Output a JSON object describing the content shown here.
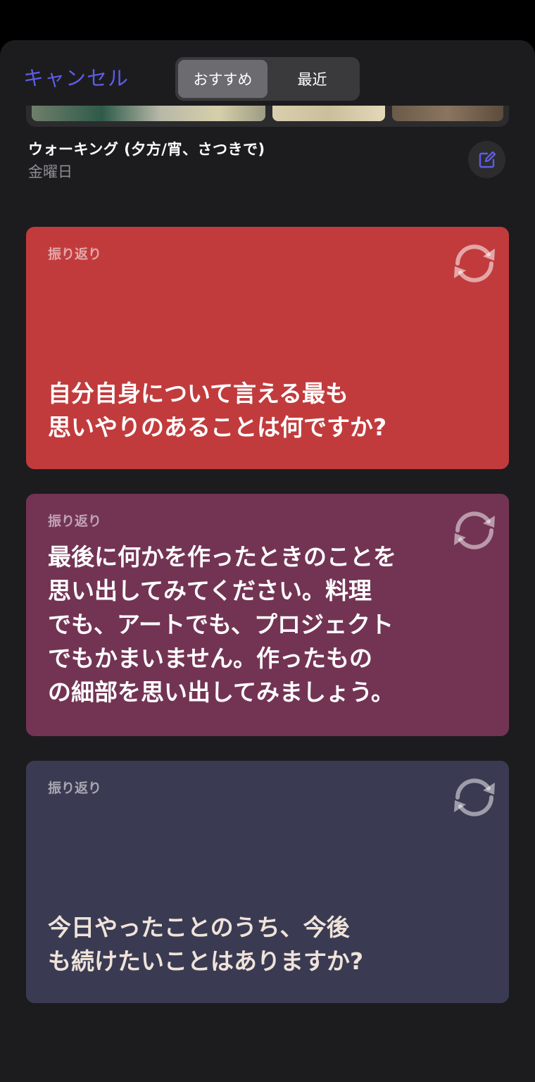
{
  "header": {
    "cancel_label": "キャンセル",
    "segments": [
      {
        "label": "おすすめ",
        "selected": true
      },
      {
        "label": "最近",
        "selected": false
      }
    ]
  },
  "entry": {
    "title": "ウォーキング (夕方/宵、さつきで)",
    "date": "金曜日",
    "edit_icon": "edit-icon"
  },
  "prompts": [
    {
      "label": "振り返り",
      "question": "自分自身について言える最も\n思いやりのあることは何ですか?",
      "color": "#c13b3d",
      "icon": "refresh-icon"
    },
    {
      "label": "振り返り",
      "question": "最後に何かを作ったときのことを\n思い出してみてください。料理\nでも、アートでも、プロジェクト\nでもかまいません。作ったもの\nの細部を思い出してみましょう。",
      "color": "#733454",
      "icon": "refresh-icon"
    },
    {
      "label": "振り返り",
      "question": "今日やったことのうち、今後\nも続けたいことはありますか?",
      "color": "#3a3b52",
      "icon": "refresh-icon"
    }
  ],
  "colors": {
    "accent": "#5e5ce6",
    "background": "#1c1c1e"
  }
}
